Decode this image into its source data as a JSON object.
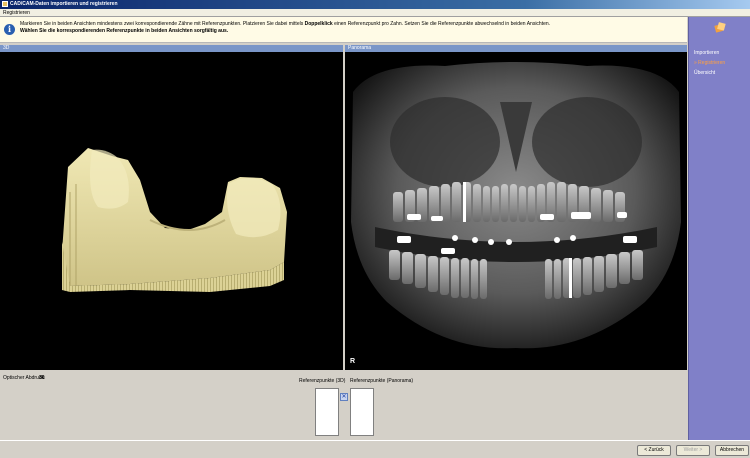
{
  "window": {
    "title": "CAD/CAM-Daten importieren und registrieren"
  },
  "menu": {
    "item": "Registrieren"
  },
  "info": {
    "line1_pre": "Markieren Sie in beiden Ansichten mindestens zwei korrespondierende Zähne mit Referenzpunkten. Platzieren Sie dabei mittels ",
    "line1_bold": "Doppelklick",
    "line1_post": " einen Referenzpunkt pro Zahn. Setzen Sie die Referenzpunkte abwechselnd in beiden Ansichten.",
    "line2": "Wählen Sie die korrespondierenden Referenzpunkte in beiden Ansichten sorgfältig aus."
  },
  "panels": {
    "left_title": "3D",
    "right_title": "Panorama",
    "right_marker": "R"
  },
  "bottom": {
    "optical_label": "Optischer Abdruck:",
    "optical_value": "36",
    "ref3d_label": "Referenzpunkte (3D)",
    "refpano_label": "Referenzpunkte (Panorama)"
  },
  "sidebar": {
    "items": [
      "Importieren",
      "Registrieren",
      "Übersicht"
    ]
  },
  "buttons": {
    "back": "< Zurück",
    "next": "Weiter >",
    "cancel": "Abbrechen"
  },
  "colors": {
    "sidebar": "#8080c8",
    "panel_header": "#7a96c8",
    "active_step": "#ffa040",
    "model": "#e6dea0"
  }
}
